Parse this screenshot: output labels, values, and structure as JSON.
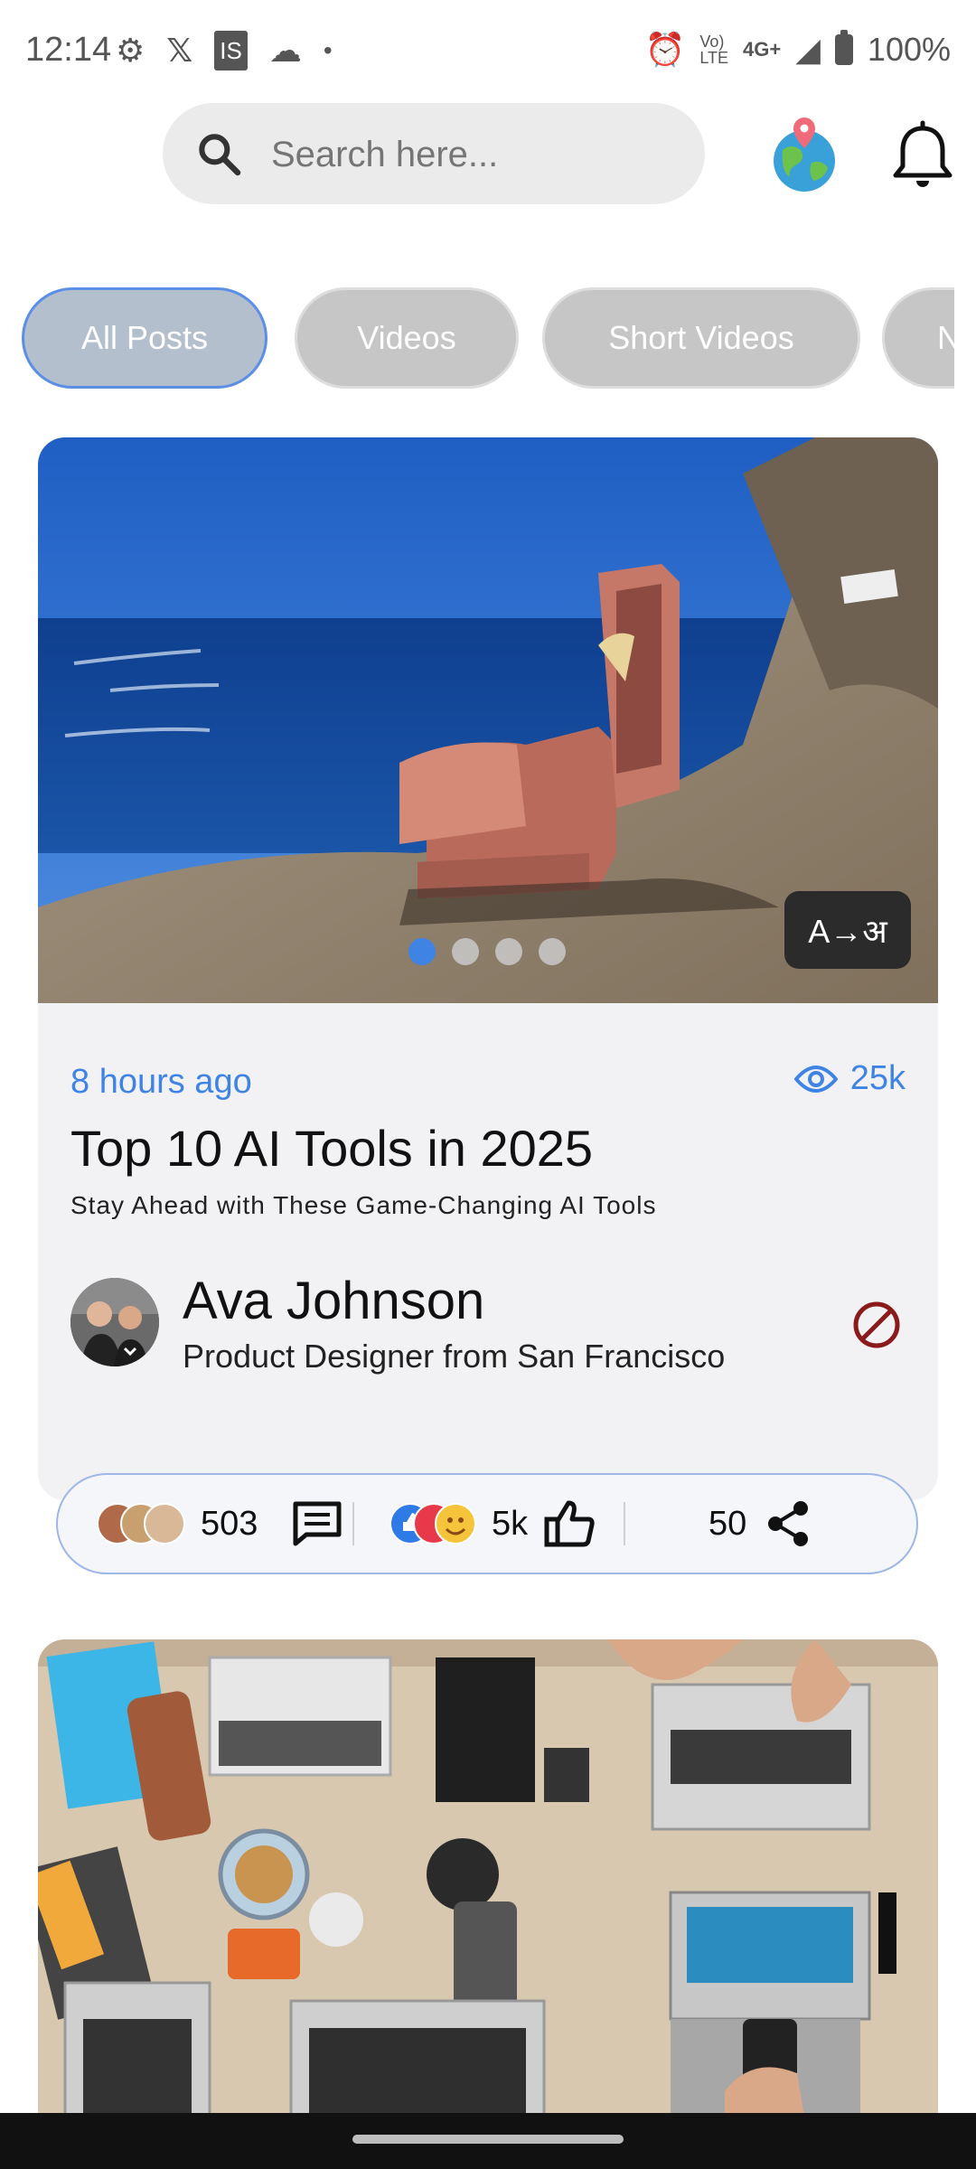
{
  "status_bar": {
    "time": "12:14",
    "battery": "100%",
    "network": "4G+",
    "left_icons": [
      "gear-icon",
      "x-icon",
      "is-icon",
      "cloud-icon",
      "dot-icon"
    ],
    "right_icons": [
      "alarm-icon",
      "volte-icon",
      "signal-icon",
      "battery-icon"
    ]
  },
  "search": {
    "placeholder": "Search here..."
  },
  "tabs": [
    {
      "label": "All Posts",
      "active": true
    },
    {
      "label": "Videos",
      "active": false
    },
    {
      "label": "Short Videos",
      "active": false
    },
    {
      "label": "N",
      "active": false
    }
  ],
  "post": {
    "carousel": {
      "count": 4,
      "active_index": 0
    },
    "translate_label": "A→अ",
    "time_ago": "8 hours ago",
    "views": "25k",
    "title": "Top 10 AI Tools in 2025",
    "subtitle": "Stay Ahead with These Game-Changing AI Tools",
    "author": {
      "name": "Ava Johnson",
      "role": "Product Designer from San Francisco"
    },
    "engagement": {
      "comments": "503",
      "reactions": "5k",
      "shares": "50"
    }
  },
  "colors": {
    "accent": "#3f84e5",
    "tab_inactive": "#c6c6c6",
    "tab_active": "#b3bfcd",
    "block_red": "#8b1a1a"
  }
}
